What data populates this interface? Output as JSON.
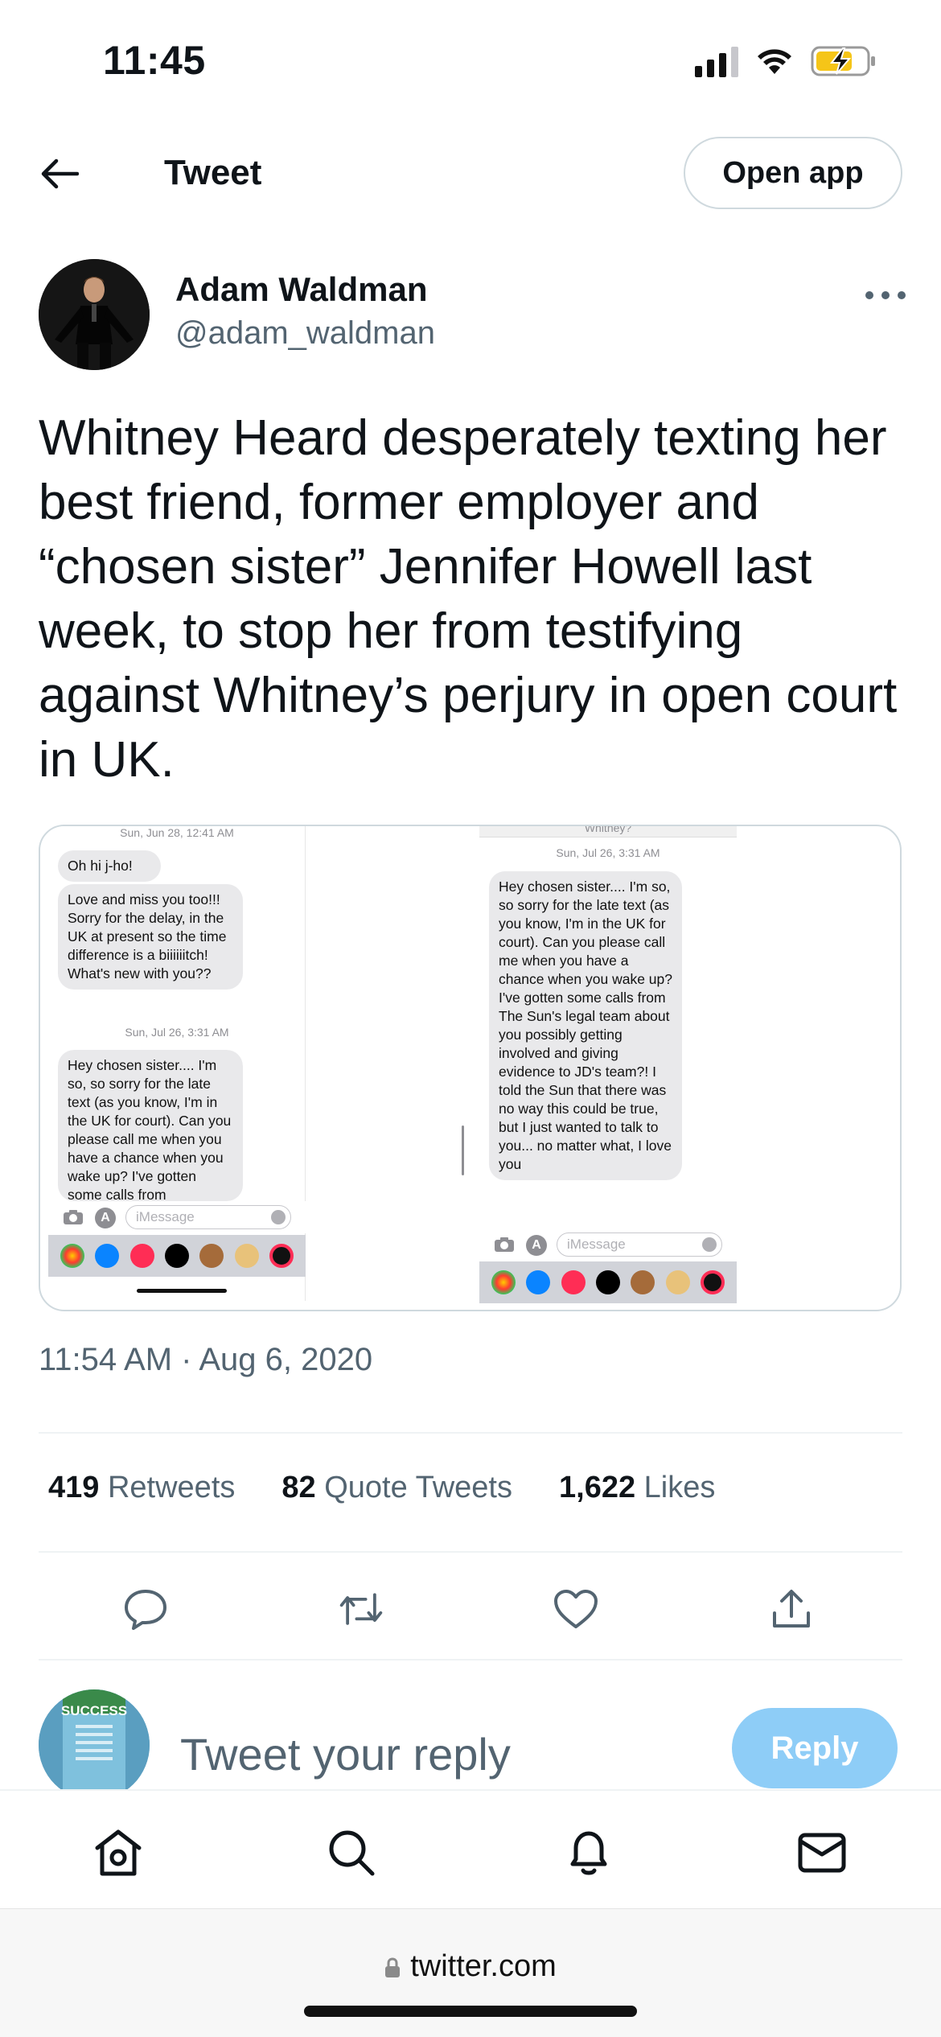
{
  "status_bar": {
    "time": "11:45"
  },
  "header": {
    "title": "Tweet",
    "open_app_label": "Open app"
  },
  "author": {
    "name": "Adam Waldman",
    "handle": "@adam_waldman"
  },
  "tweet": {
    "text": "Whitney Heard desperately texting her best friend, former employer and “chosen sister” Jennifer Howell last week, to stop her from testifying against Whitney’s perjury in open court in UK.",
    "timestamp": "11:54 AM · Aug 6, 2020"
  },
  "media": {
    "left": {
      "date_1": "Sun, Jun 28, 12:41 AM",
      "msg_1": "Oh hi j-ho!",
      "msg_2": "Love and miss you too!!! Sorry for the delay, in the UK at present so the time difference is a biiiiiitch! What's new with you??",
      "date_2": "Sun, Jul 26, 3:31 AM",
      "msg_3": "Hey chosen sister.... I'm so, so sorry for the late text (as you know, I'm in the UK for court). Can you please call me when you have a chance when you wake up? I've gotten some calls from",
      "input_placeholder": "iMessage"
    },
    "right": {
      "top_fragment": "Whitney?",
      "date": "Sun, Jul 26, 3:31 AM",
      "msg": "Hey chosen sister.... I'm so, so sorry for the late text (as you know, I'm in the UK for court). Can you please call me when you have a chance when you wake up? I've gotten some calls from The Sun's legal team about you possibly getting involved and giving evidence to JD's team?! I told the Sun that there was no way this could be true, but I just wanted to talk to you... no matter what, I love you",
      "input_placeholder": "iMessage"
    }
  },
  "stats": [
    {
      "count": "419",
      "label": "Retweets"
    },
    {
      "count": "82",
      "label": "Quote Tweets"
    },
    {
      "count": "1,622",
      "label": "Likes"
    }
  ],
  "reply": {
    "placeholder": "Tweet your reply",
    "button_label": "Reply",
    "avatar_text": "SUCCESS"
  },
  "browser": {
    "url": "twitter.com"
  },
  "colors": {
    "accent": "#1d9bf0",
    "reply_disabled": "#8ecdf7",
    "secondary_text": "#536471",
    "border": "#cfd9de"
  }
}
